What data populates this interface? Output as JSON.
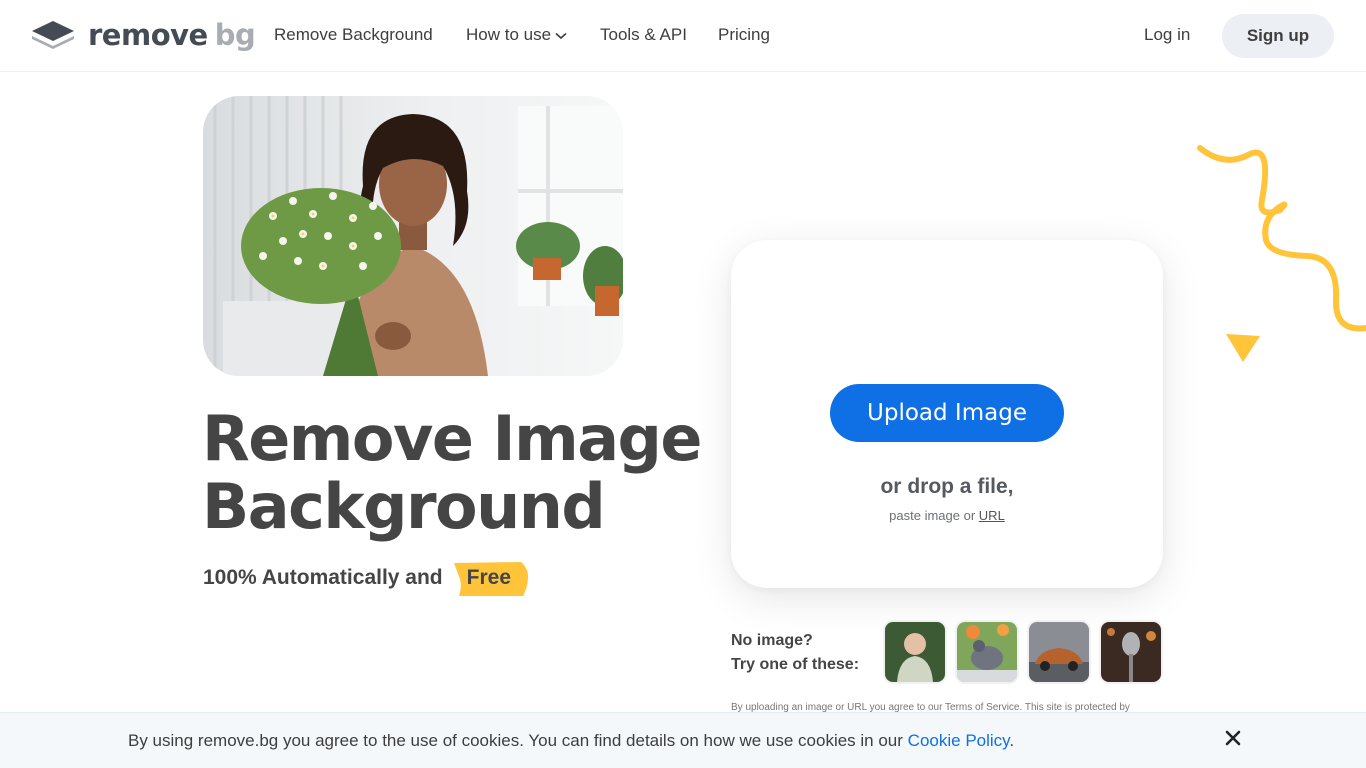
{
  "header": {
    "logo_primary": "remove",
    "logo_secondary": "bg",
    "nav": [
      {
        "label": "Remove Background"
      },
      {
        "label": "How to use"
      },
      {
        "label": "Tools & API"
      },
      {
        "label": "Pricing"
      }
    ],
    "login_label": "Log in",
    "signup_label": "Sign up"
  },
  "hero": {
    "title_line1": "Remove Image",
    "title_line2": "Background",
    "subtitle": "100% Automatically and",
    "badge": "Free"
  },
  "upload": {
    "button_label": "Upload Image",
    "drop_text": "or drop a file,",
    "paste_prefix": "paste image or",
    "url_link": "URL"
  },
  "samples": {
    "prompt_line1": "No image?",
    "prompt_line2": "Try one of these:"
  },
  "terms": "By uploading an image or URL you agree to our Terms of Service. This site is protected by",
  "cookie": {
    "text": "By using remove.bg you agree to the use of cookies. You can find details on how we use cookies in our",
    "link": "Cookie Policy",
    "suffix": "."
  },
  "colors": {
    "accent": "#0f70e6",
    "badge": "#ffc43a",
    "text": "#454545"
  }
}
